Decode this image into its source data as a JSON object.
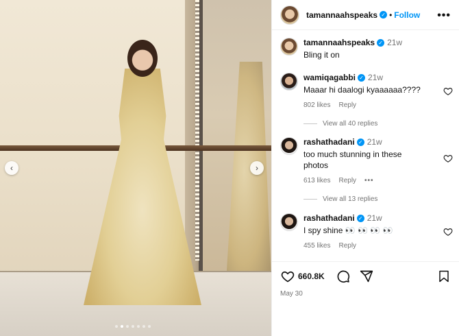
{
  "post": {
    "username": "tamannaahspeaks",
    "follow_label": "Follow",
    "more_label": "•••",
    "caption": {
      "username": "tamannaahspeaks",
      "time": "21w",
      "text": "Bling it on"
    },
    "likes_count": "660.8K",
    "date": "May 30"
  },
  "carousel": {
    "prev_label": "‹",
    "next_label": "›",
    "dot_count": 7,
    "active_dot": 1
  },
  "comments": [
    {
      "username": "wamiqagabbi",
      "time": "21w",
      "text": "Maaar hi daalogi kyaaaaaa????",
      "likes": "802 likes",
      "reply_label": "Reply",
      "view_replies": "View all 40 replies"
    },
    {
      "username": "rashathadani",
      "time": "21w",
      "text": "too much stunning in these photos",
      "likes": "613 likes",
      "reply_label": "Reply",
      "more": "•••",
      "view_replies": "View all 13 replies"
    },
    {
      "username": "rashathadani",
      "time": "21w",
      "text": "I spy shine 👀 👀 👀 👀",
      "likes": "455 likes",
      "reply_label": "Reply"
    }
  ],
  "icons": [
    "heart-icon",
    "comment-icon",
    "share-icon",
    "bookmark-icon",
    "verified-icon",
    "more-icon"
  ],
  "colors": {
    "accent": "#0095f6",
    "muted": "#737373",
    "border": "#efefef"
  }
}
